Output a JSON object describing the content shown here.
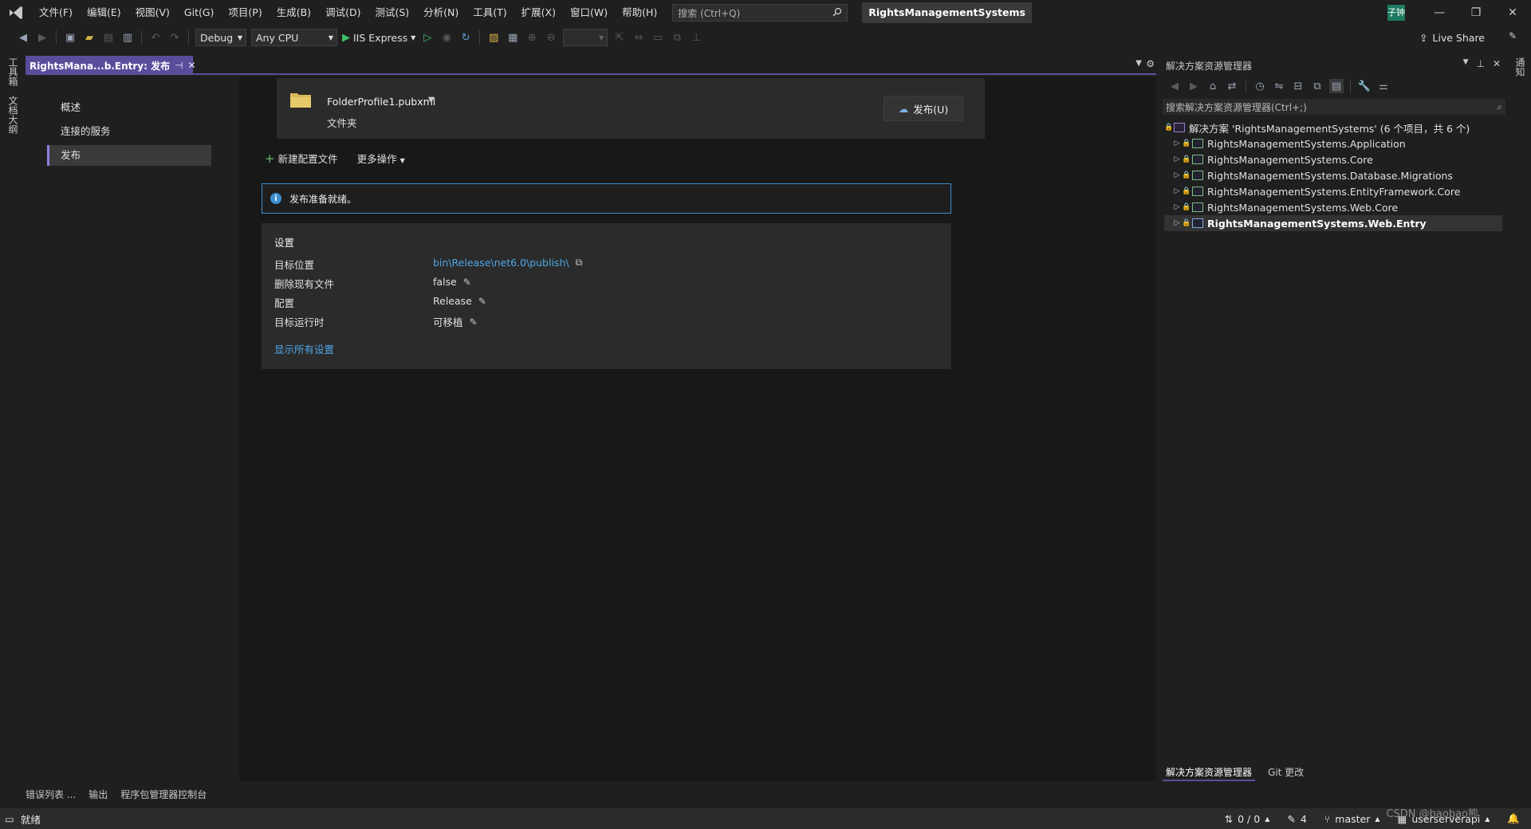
{
  "menubar": {
    "items": [
      "文件(F)",
      "编辑(E)",
      "视图(V)",
      "Git(G)",
      "项目(P)",
      "生成(B)",
      "调试(D)",
      "测试(S)",
      "分析(N)",
      "工具(T)",
      "扩展(X)",
      "窗口(W)",
      "帮助(H)"
    ],
    "search_placeholder": "搜索 (Ctrl+Q)",
    "solution_title": "RightsManagementSystems",
    "user_badge": "子钟"
  },
  "toolbar": {
    "configuration": "Debug",
    "platform": "Any CPU",
    "run_target": "IIS Express",
    "live_share": "Live Share"
  },
  "left_strip": {
    "tabs": [
      "工具箱",
      "文档大纲"
    ]
  },
  "doc_tab": {
    "title": "RightsMana...b.Entry: 发布",
    "pin": "⊣",
    "close": "✕"
  },
  "publish_page": {
    "nav": [
      "概述",
      "连接的服务",
      "发布"
    ],
    "profile_name": "FolderProfile1.pubxml",
    "profile_type": "文件夹",
    "publish_button": "发布(U)",
    "actions": {
      "new_profile": "新建配置文件",
      "more_actions": "更多操作"
    },
    "info_message": "发布准备就绪。",
    "settings": {
      "title": "设置",
      "rows": [
        {
          "label": "目标位置",
          "value": "bin\\Release\\net6.0\\publish\\"
        },
        {
          "label": "删除现有文件",
          "value": "false"
        },
        {
          "label": "配置",
          "value": "Release"
        },
        {
          "label": "目标运行时",
          "value": "可移植"
        }
      ],
      "show_all": "显示所有设置"
    }
  },
  "solution_explorer": {
    "title": "解决方案资源管理器",
    "search_placeholder": "搜索解决方案资源管理器(Ctrl+;)",
    "solution_node": "解决方案 'RightsManagementSystems' (6 个项目，共 6 个)",
    "projects": [
      "RightsManagementSystems.Application",
      "RightsManagementSystems.Core",
      "RightsManagementSystems.Database.Migrations",
      "RightsManagementSystems.EntityFramework.Core",
      "RightsManagementSystems.Web.Core",
      "RightsManagementSystems.Web.Entry"
    ],
    "tabs": [
      "解决方案资源管理器",
      "Git 更改"
    ]
  },
  "right_strip": {
    "tabs": [
      "通知"
    ]
  },
  "bottom_tabs": [
    "错误列表 ...",
    "输出",
    "程序包管理器控制台"
  ],
  "statusbar": {
    "status": "就绪",
    "sync": "0 / 0",
    "pending": "4",
    "branch": "master",
    "repo": "userserverapi"
  },
  "watermark": "CSDN @baobao熊",
  "colors": {
    "accent": "#5a4d9c",
    "link": "#4fa6e6",
    "info": "#3c8fcf"
  }
}
